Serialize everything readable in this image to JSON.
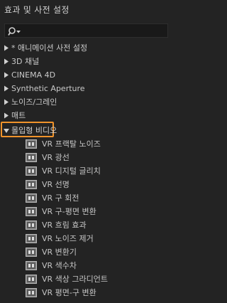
{
  "panel": {
    "title": "효과 및 사전 설정",
    "search": {
      "icon": "search-icon",
      "value": ""
    }
  },
  "folders": [
    {
      "label": "* 애니메이션 사전 설정"
    },
    {
      "label": "3D 채널"
    },
    {
      "label": "CINEMA 4D"
    },
    {
      "label": "Synthetic Aperture"
    },
    {
      "label": "노이즈/그레인"
    },
    {
      "label": "매트"
    }
  ],
  "open_folder": {
    "label": "몰입형 비디오",
    "highlight_color": "#f0932b",
    "items": [
      {
        "label": "VR 프랙탈 노이즈"
      },
      {
        "label": "VR 광선"
      },
      {
        "label": "VR 디지털 글리치"
      },
      {
        "label": "VR 선명"
      },
      {
        "label": "VR 구 회전"
      },
      {
        "label": "VR 구-평면 변환"
      },
      {
        "label": "VR 흐림 효과"
      },
      {
        "label": "VR 노이즈 제거"
      },
      {
        "label": "VR 변환기"
      },
      {
        "label": "VR 색수차"
      },
      {
        "label": "VR 색상 그라디언트"
      },
      {
        "label": "VR 평면-구 변환"
      }
    ]
  },
  "colors": {
    "background": "#232323",
    "text": "#c9c9c9",
    "accent": "#f0932b"
  }
}
